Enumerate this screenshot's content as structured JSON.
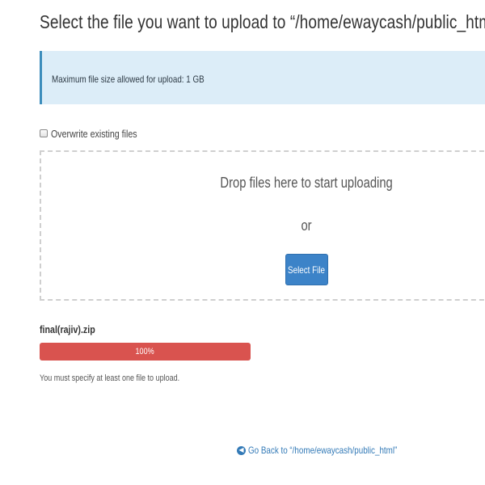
{
  "page": {
    "title": "Select the file you want to upload to “/home/ewaycash/public_html”."
  },
  "info": {
    "max_size_text": "Maximum file size allowed for upload: 1 GB"
  },
  "options": {
    "overwrite_label": "Overwrite existing files",
    "overwrite_checked": false
  },
  "dropzone": {
    "drop_text": "Drop files here to start uploading",
    "or_text": "or",
    "select_button_label": "Select File"
  },
  "upload": {
    "filename": "final(rajiv).zip",
    "progress_percent": 100,
    "progress_label": "100%",
    "progress_color": "#d9534f",
    "error_message": "You must specify at least one file to upload."
  },
  "footer": {
    "back_link_label": "Go Back to “/home/ewaycash/public_html”",
    "back_icon": "circle-arrow-left-icon"
  },
  "colors": {
    "accent": "#337ab7",
    "info_background": "#dcedf8",
    "button": "#3c83c8"
  }
}
